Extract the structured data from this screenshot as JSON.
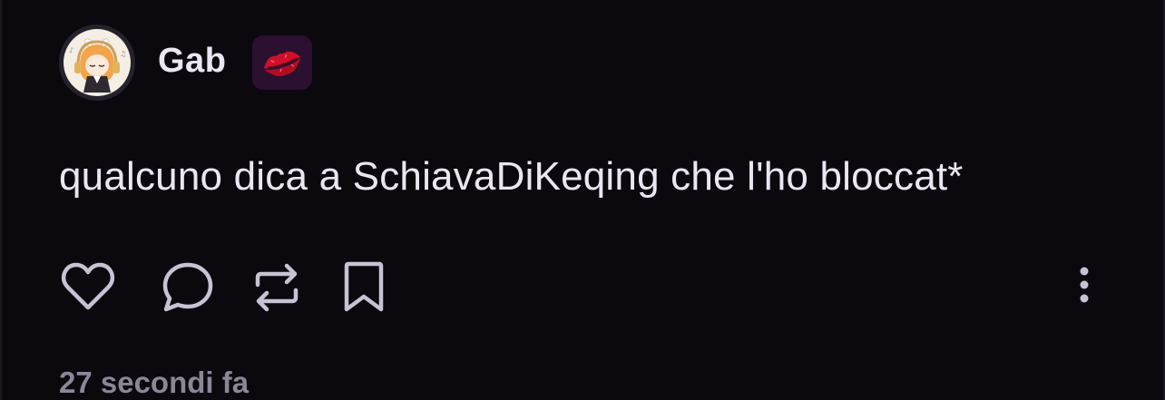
{
  "post": {
    "author": {
      "name": "Gab",
      "avatar_icon": "anime-girl-headphones-avatar",
      "badge_icon": "kiss-lips-icon"
    },
    "text": "qualcuno dica a SchiavaDiKeqing che l'ho bloccat*",
    "actions": {
      "like_icon": "heart-icon",
      "comment_icon": "comment-icon",
      "repost_icon": "repost-icon",
      "save_icon": "bookmark-icon",
      "more_icon": "more-vertical-icon"
    },
    "timestamp": "27 secondi fa"
  },
  "colors": {
    "background": "#0b080e",
    "text": "#ece6f2",
    "muted": "#8c8696",
    "icon": "#c9c2d3",
    "badge_bg": "#2b1030",
    "lips": "#d0102a"
  }
}
